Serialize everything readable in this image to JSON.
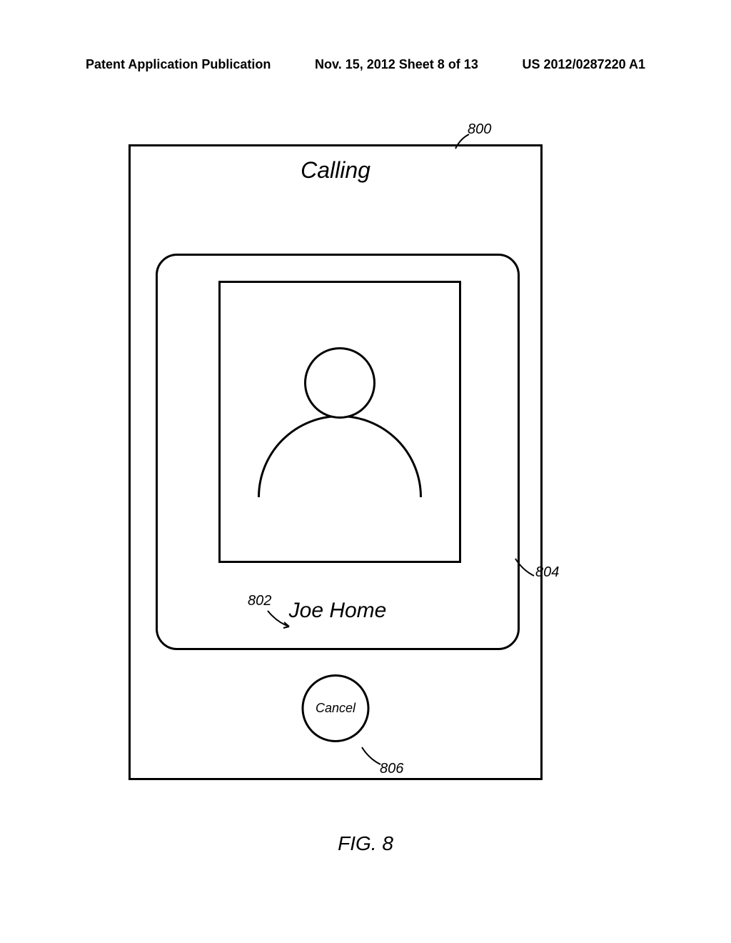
{
  "header": {
    "left": "Patent Application Publication",
    "center": "Nov. 15, 2012  Sheet 8 of 13",
    "right": "US 2012/0287220 A1"
  },
  "screen": {
    "title": "Calling",
    "contact_name": "Joe Home",
    "cancel_label": "Cancel"
  },
  "refs": {
    "r800": "800",
    "r802": "802",
    "r804": "804",
    "r806": "806"
  },
  "caption": "FIG. 8"
}
